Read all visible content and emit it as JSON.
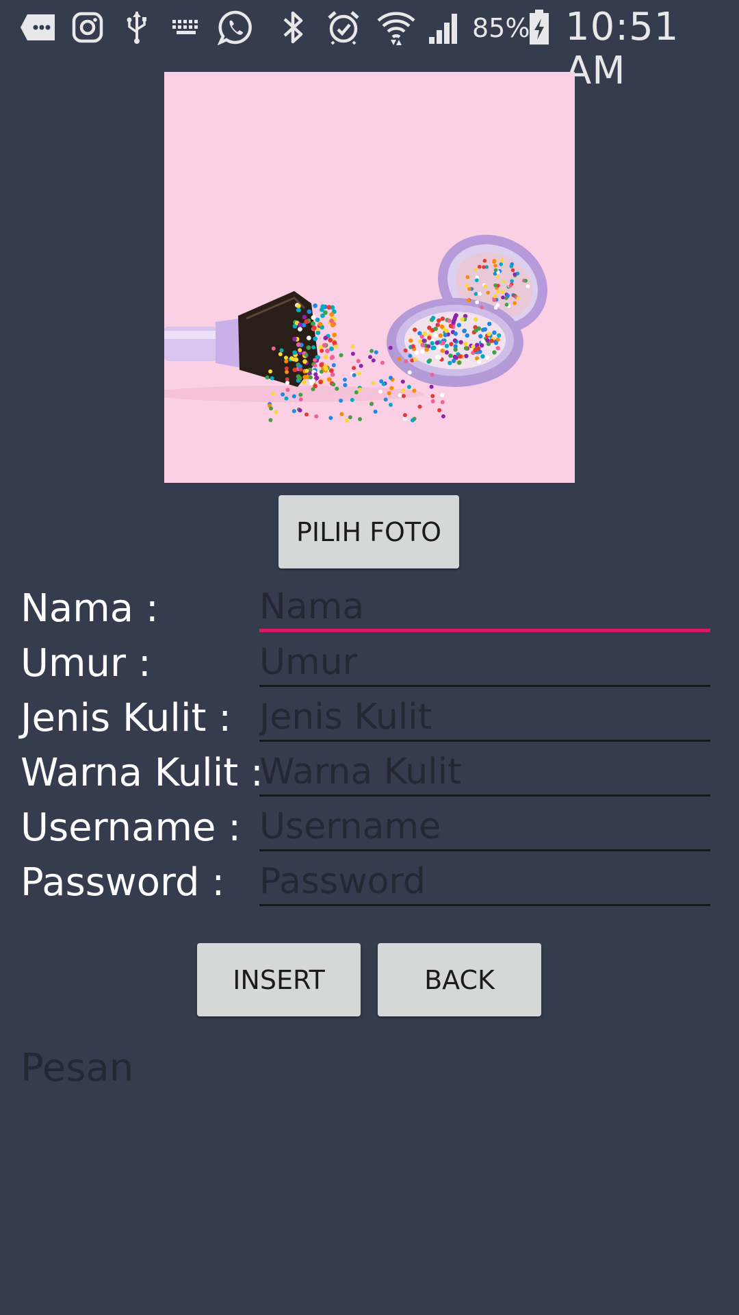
{
  "status_bar": {
    "icons": [
      "message-icon",
      "instagram-icon",
      "usb-icon",
      "keyboard-icon",
      "whatsapp-icon",
      "bluetooth-icon",
      "alarm-icon",
      "wifi-icon",
      "signal-icon",
      "battery-charging-icon"
    ],
    "battery_percent": "85%",
    "time": "10:51 AM"
  },
  "photo": {
    "description_icon": "makeup-brush-sprinkles-image",
    "background_color": "#fbcfe4"
  },
  "pick_photo_button": {
    "label": "PILIH FOTO"
  },
  "form": {
    "fields": [
      {
        "label": "Nama :",
        "placeholder": "Nama",
        "value": ""
      },
      {
        "label": "Umur :",
        "placeholder": "Umur",
        "value": ""
      },
      {
        "label": "Jenis Kulit :",
        "placeholder": "Jenis Kulit",
        "value": ""
      },
      {
        "label": "Warna Kulit :",
        "placeholder": "Warna Kulit",
        "value": ""
      },
      {
        "label": "Username :",
        "placeholder": "Username",
        "value": ""
      },
      {
        "label": "Password :",
        "placeholder": "Password",
        "value": ""
      }
    ],
    "focused_index": 0
  },
  "actions": {
    "insert_label": "INSERT",
    "back_label": "BACK"
  },
  "message": {
    "text": "Pesan"
  },
  "colors": {
    "background": "#343c4d",
    "focus_accent": "#d81b60",
    "button_bg": "#d6d7d7"
  }
}
